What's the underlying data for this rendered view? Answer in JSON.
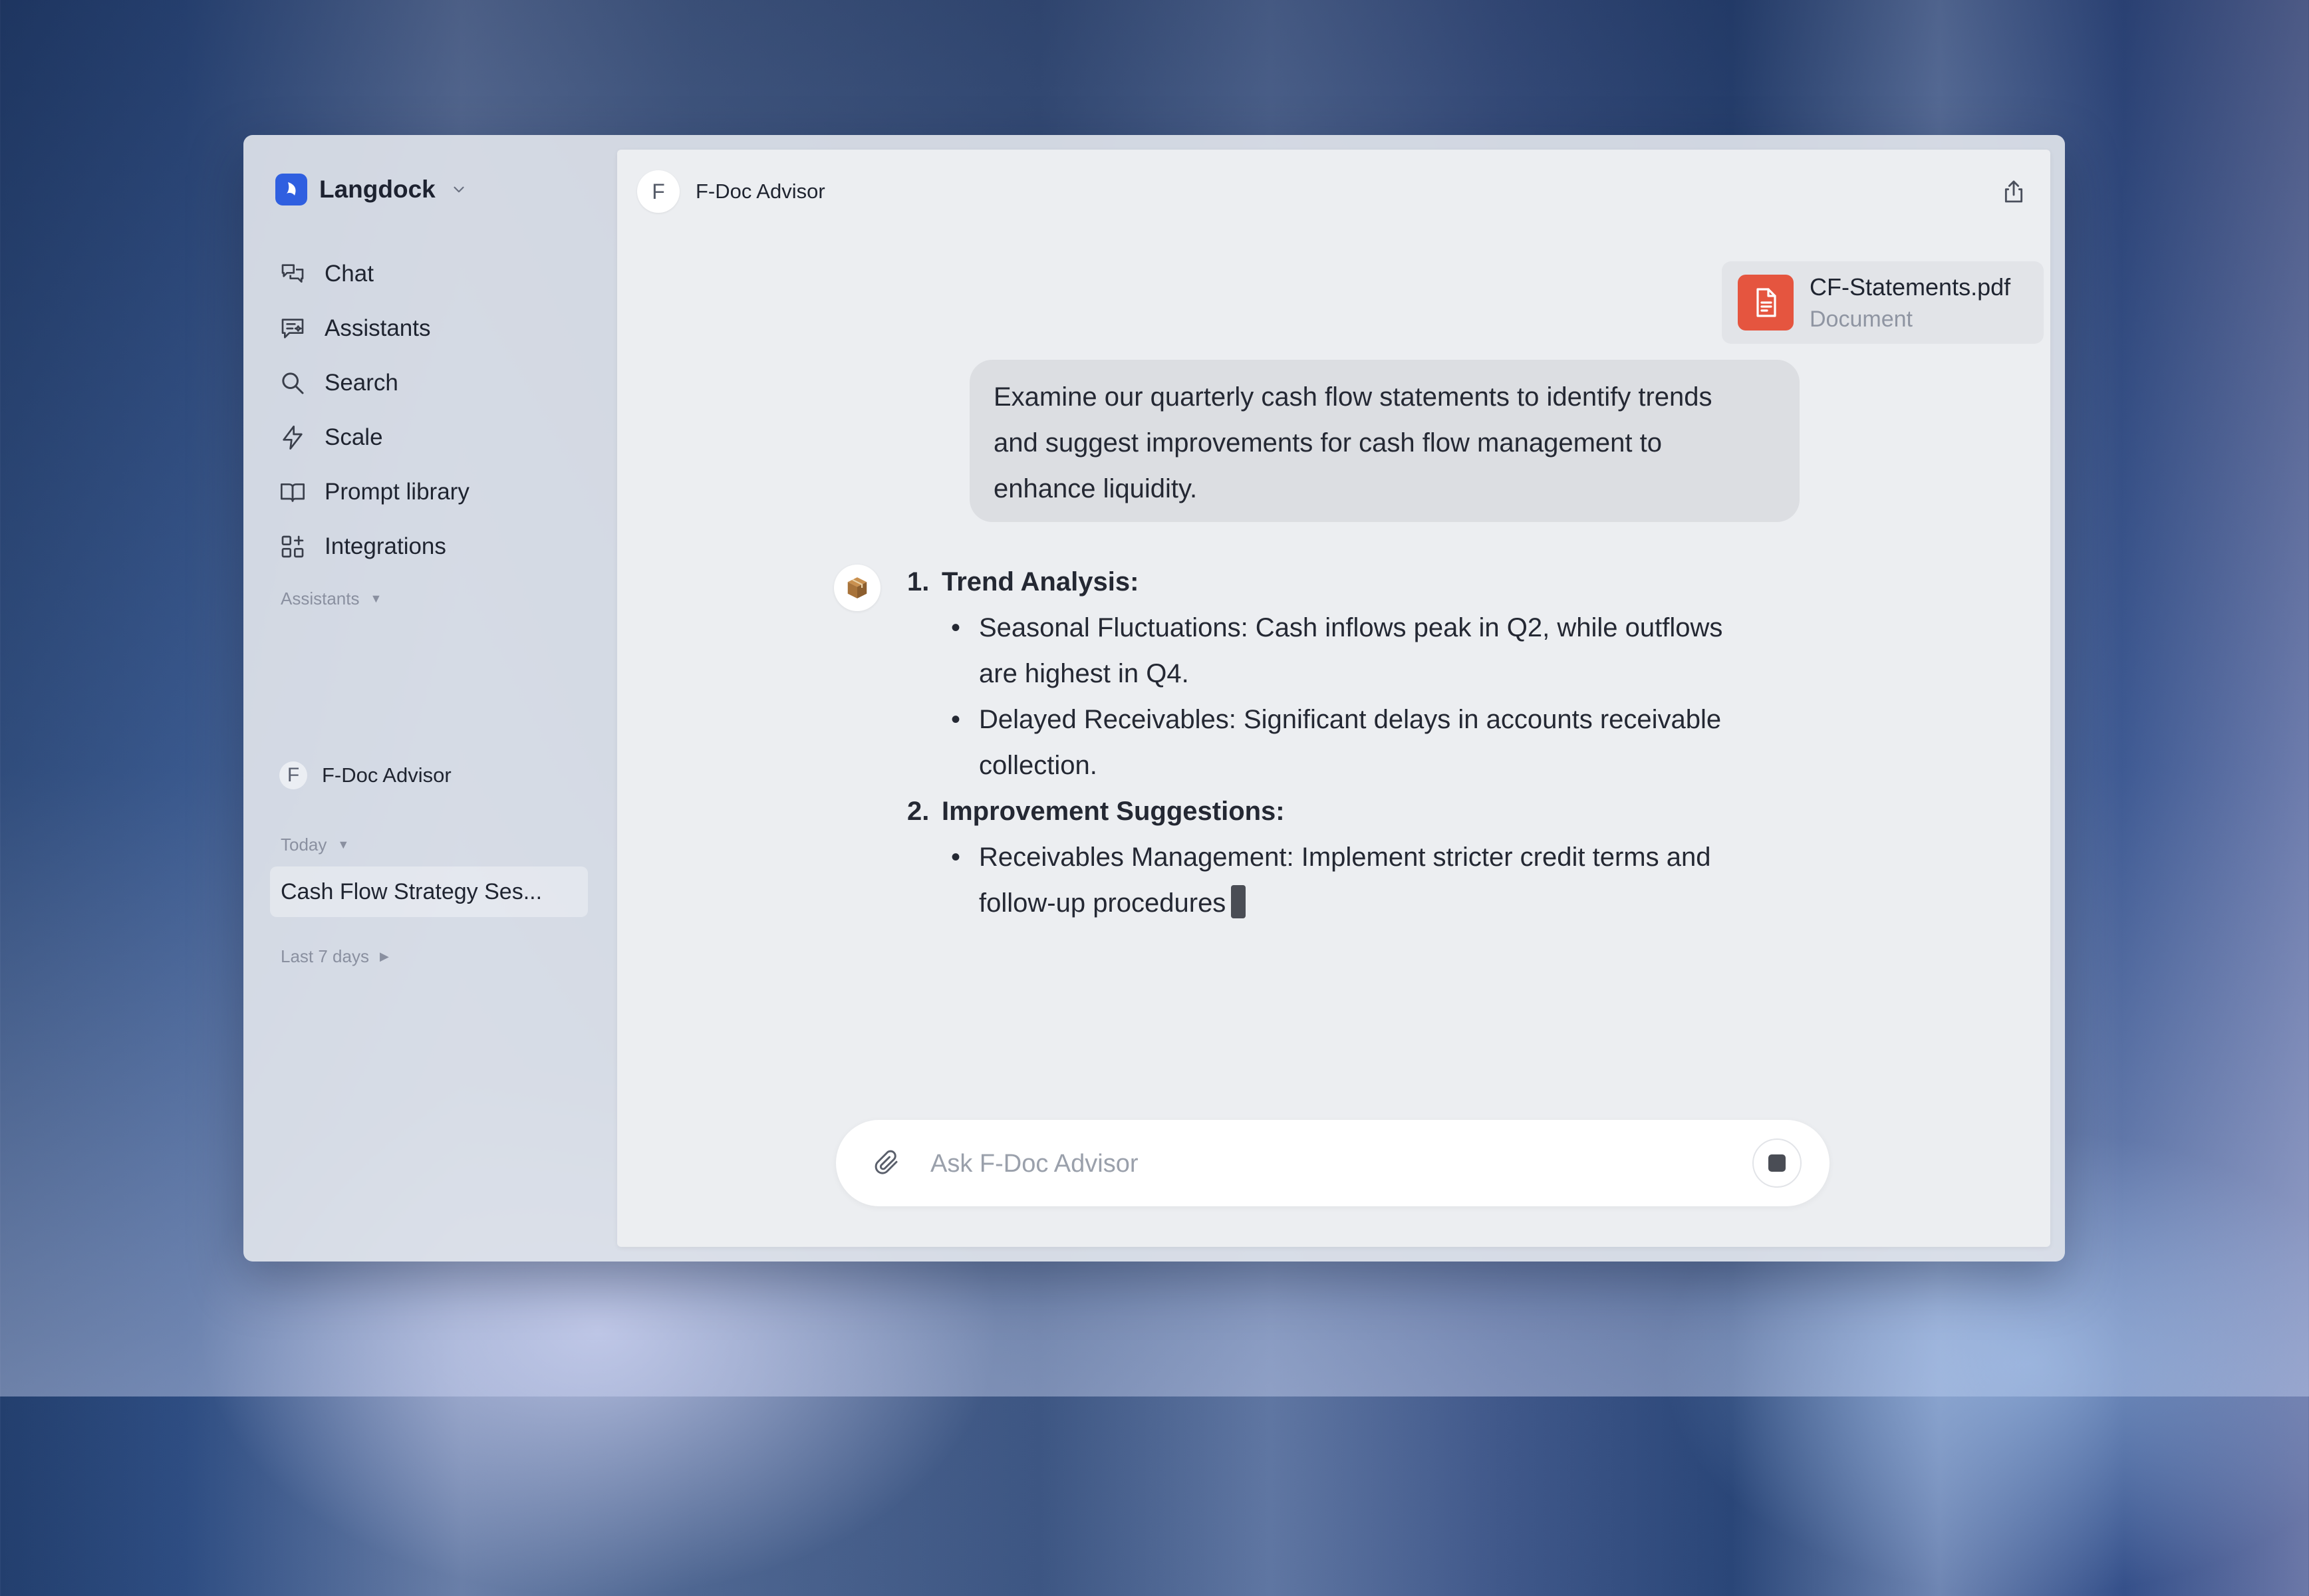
{
  "app": {
    "name": "Langdock"
  },
  "sidebar": {
    "nav": [
      {
        "label": "Chat",
        "icon": "chat-icon"
      },
      {
        "label": "Assistants",
        "icon": "assistants-icon"
      },
      {
        "label": "Search",
        "icon": "search-icon"
      },
      {
        "label": "Scale",
        "icon": "lightning-icon"
      },
      {
        "label": "Prompt library",
        "icon": "book-icon"
      },
      {
        "label": "Integrations",
        "icon": "grid-plus-icon"
      }
    ],
    "assistants_section": "Assistants",
    "assistants": [
      {
        "initial": "F",
        "name": "F-Doc Advisor"
      }
    ],
    "today_section": "Today",
    "history": [
      {
        "title": "Cash Flow Strategy Ses..."
      }
    ],
    "last7_section": "Last 7 days"
  },
  "header": {
    "avatar_initial": "F",
    "title": "F-Doc Advisor",
    "share_icon": "share-icon"
  },
  "attachment": {
    "name": "CF-Statements.pdf",
    "type": "Document",
    "icon": "document-icon",
    "color": "#e5553f"
  },
  "user_message": {
    "lines": [
      "Examine our quarterly cash flow statements to identify trends",
      "and suggest improvements for cash flow management to",
      "enhance liquidity."
    ]
  },
  "assistant_message": {
    "avatar_icon": "package-icon",
    "sections": [
      {
        "number": "1.",
        "heading": "Trend Analysis:",
        "bullets": [
          {
            "lines": [
              "Seasonal Fluctuations: Cash inflows peak in Q2, while outflows",
              "are highest in Q4."
            ]
          },
          {
            "lines": [
              "Delayed Receivables: Significant delays in accounts receivable",
              "collection."
            ]
          }
        ]
      },
      {
        "number": "2.",
        "heading": "Improvement Suggestions:",
        "bullets": [
          {
            "lines": [
              "Receivables Management: Implement stricter credit terms and",
              "follow-up procedures"
            ]
          }
        ]
      }
    ]
  },
  "composer": {
    "placeholder": "Ask F-Doc Advisor",
    "value": "",
    "attach_icon": "paperclip-icon",
    "stop_icon": "stop-icon"
  }
}
